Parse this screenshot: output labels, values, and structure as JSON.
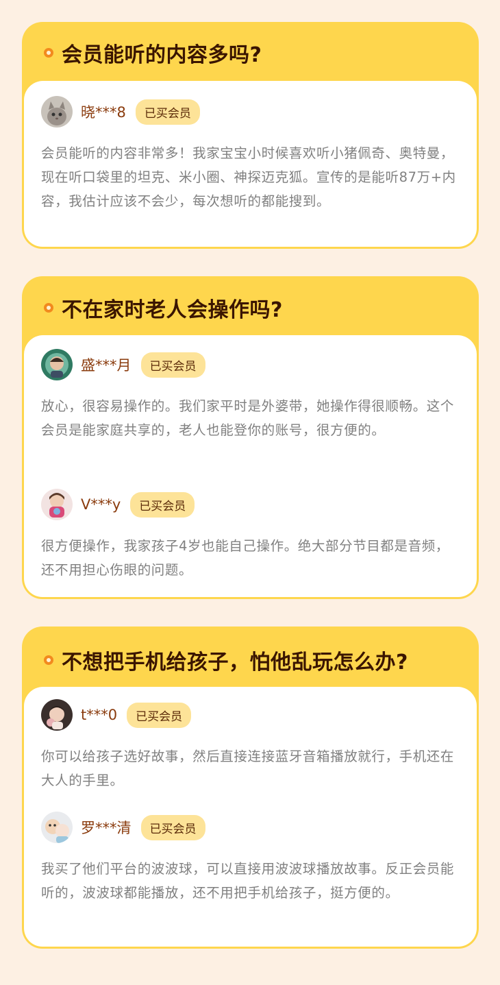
{
  "accent_colors": {
    "card_bg": "#fed64d",
    "page_bg": "#fdf0e3",
    "badge_bg": "#fde398",
    "dot": "#f28a1e"
  },
  "sections": [
    {
      "title": "会员能听的内容多吗?",
      "reviews": [
        {
          "user": "晓***8",
          "badge": "已买会员",
          "avatar": "cat-avatar",
          "text": "会员能听的内容非常多！我家宝宝小时候喜欢听小猪佩奇、奥特曼，现在听口袋里的坦克、米小圈、神探迈克狐。宣传的是能听87万+内容，我估计应该不会少，每次想听的都能搜到。"
        }
      ]
    },
    {
      "title": "不在家时老人会操作吗?",
      "reviews": [
        {
          "user": "盛***月",
          "badge": "已买会员",
          "avatar": "child-avatar",
          "text": "放心，很容易操作的。我们家平时是外婆带，她操作得很顺畅。这个会员是能家庭共享的，老人也能登你的账号，很方便的。"
        },
        {
          "user": "V***y",
          "badge": "已买会员",
          "avatar": "girl-avatar",
          "text": "很方便操作，我家孩子4岁也能自己操作。绝大部分节目都是音频，还不用担心伤眼的问题。"
        }
      ]
    },
    {
      "title": "不想把手机给孩子，怕他乱玩怎么办?",
      "reviews": [
        {
          "user": "t***0",
          "badge": "已买会员",
          "avatar": "baby-avatar",
          "text": "你可以给孩子选好故事，然后直接连接蓝牙音箱播放就行，手机还在大人的手里。"
        },
        {
          "user": "罗***清",
          "badge": "已买会员",
          "avatar": "dog-avatar",
          "text": "我买了他们平台的波波球，可以直接用波波球播放故事。反正会员能听的，波波球都能播放，还不用把手机给孩子，挺方便的。"
        }
      ]
    }
  ]
}
